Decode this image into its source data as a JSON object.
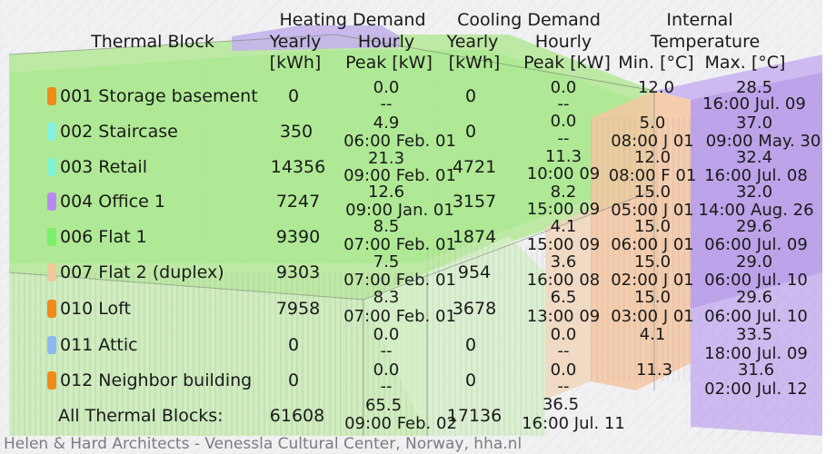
{
  "header": {
    "heating_demand": "Heating Demand",
    "cooling_demand": "Cooling Demand",
    "internal": "Internal",
    "thermal_block": "Thermal Block",
    "heat_yearly": "Yearly",
    "heat_hourly": "Hourly",
    "cool_yearly": "Yearly",
    "cool_hourly": "Hourly",
    "temperature": "Temperature",
    "heat_yearly_unit": "[kWh]",
    "heat_peak_unit": "Peak [kW]",
    "cool_yearly_unit": "[kWh]",
    "cool_peak_unit": "Peak [kW]",
    "min_temp": "Min. [°C]",
    "max_temp": "Max. [°C]"
  },
  "rows": [
    {
      "name": "001 Storage basement",
      "color": "#f08a1a",
      "heat_yearly": "0",
      "heat_peak": "0.0",
      "heat_peak_time": "--",
      "cool_yearly": "0",
      "cool_peak": "0.0",
      "cool_peak_time": "--",
      "min_temp": "12.0",
      "min_time": "",
      "max_temp": "28.5",
      "max_time": "16:00 Jul. 09"
    },
    {
      "name": "002 Staircase",
      "color": "#84f0e0",
      "heat_yearly": "350",
      "heat_peak": "4.9",
      "heat_peak_time": "06:00 Feb. 01",
      "cool_yearly": "0",
      "cool_peak": "0.0",
      "cool_peak_time": "--",
      "min_temp": "5.0",
      "min_time": "08:00 J 01",
      "max_temp": "37.0",
      "max_time": "09:00 May. 30"
    },
    {
      "name": "003 Retail",
      "color": "#7ef4d4",
      "heat_yearly": "14356",
      "heat_peak": "21.3",
      "heat_peak_time": "09:00 Feb. 01",
      "cool_yearly": "4721",
      "cool_peak": "11.3",
      "cool_peak_time": "10:00 09",
      "min_temp": "12.0",
      "min_time": "08:00 F 01",
      "max_temp": "32.4",
      "max_time": "16:00 Jul. 08"
    },
    {
      "name": "004 Office 1",
      "color": "#b88af0",
      "heat_yearly": "7247",
      "heat_peak": "12.6",
      "heat_peak_time": "09:00 Jan. 01",
      "cool_yearly": "3157",
      "cool_peak": "8.2",
      "cool_peak_time": "15:00 09",
      "min_temp": "15.0",
      "min_time": "05:00 J 01",
      "max_temp": "32.0",
      "max_time": "14:00 Aug. 26"
    },
    {
      "name": "006 Flat 1",
      "color": "#7cf06a",
      "heat_yearly": "9390",
      "heat_peak": "8.5",
      "heat_peak_time": "07:00 Feb. 01",
      "cool_yearly": "1874",
      "cool_peak": "4.1",
      "cool_peak_time": "15:00 09",
      "min_temp": "15.0",
      "min_time": "06:00 J 01",
      "max_temp": "29.6",
      "max_time": "06:00 Jul. 09"
    },
    {
      "name": "007 Flat 2 (duplex)",
      "color": "#f0c89c",
      "heat_yearly": "9303",
      "heat_peak": "7.5",
      "heat_peak_time": "07:00 Feb. 01",
      "cool_yearly": "954",
      "cool_peak": "3.6",
      "cool_peak_time": "16:00 08",
      "min_temp": "15.0",
      "min_time": "02:00 J 01",
      "max_temp": "29.0",
      "max_time": "06:00 Jul. 10"
    },
    {
      "name": "010 Loft",
      "color": "#f08a1a",
      "heat_yearly": "7958",
      "heat_peak": "8.3",
      "heat_peak_time": "07:00 Feb. 01",
      "cool_yearly": "3678",
      "cool_peak": "6.5",
      "cool_peak_time": "13:00 09",
      "min_temp": "15.0",
      "min_time": "03:00 J 01",
      "max_temp": "29.6",
      "max_time": "06:00 Jul. 10"
    },
    {
      "name": "011 Attic",
      "color": "#8cb8f0",
      "heat_yearly": "0",
      "heat_peak": "0.0",
      "heat_peak_time": "--",
      "cool_yearly": "0",
      "cool_peak": "0.0",
      "cool_peak_time": "--",
      "min_temp": "4.1",
      "min_time": "",
      "max_temp": "33.5",
      "max_time": "18:00 Jul. 09"
    },
    {
      "name": "012 Neighbor building",
      "color": "#f08a1a",
      "heat_yearly": "0",
      "heat_peak": "0.0",
      "heat_peak_time": "--",
      "cool_yearly": "0",
      "cool_peak": "0.0",
      "cool_peak_time": "--",
      "min_temp": "11.3",
      "min_time": "",
      "max_temp": "31.6",
      "max_time": "02:00 Jul. 12"
    }
  ],
  "total": {
    "name": "All Thermal Blocks:",
    "heat_yearly": "61608",
    "heat_peak": "65.5",
    "heat_peak_time": "09:00 Feb. 02",
    "cool_yearly": "17136",
    "cool_peak": "36.5",
    "cool_peak_time": "16:00 Jul. 11"
  },
  "credit": "Helen & Hard Architects - Venessla Cultural Center, Norway, hha.nl"
}
